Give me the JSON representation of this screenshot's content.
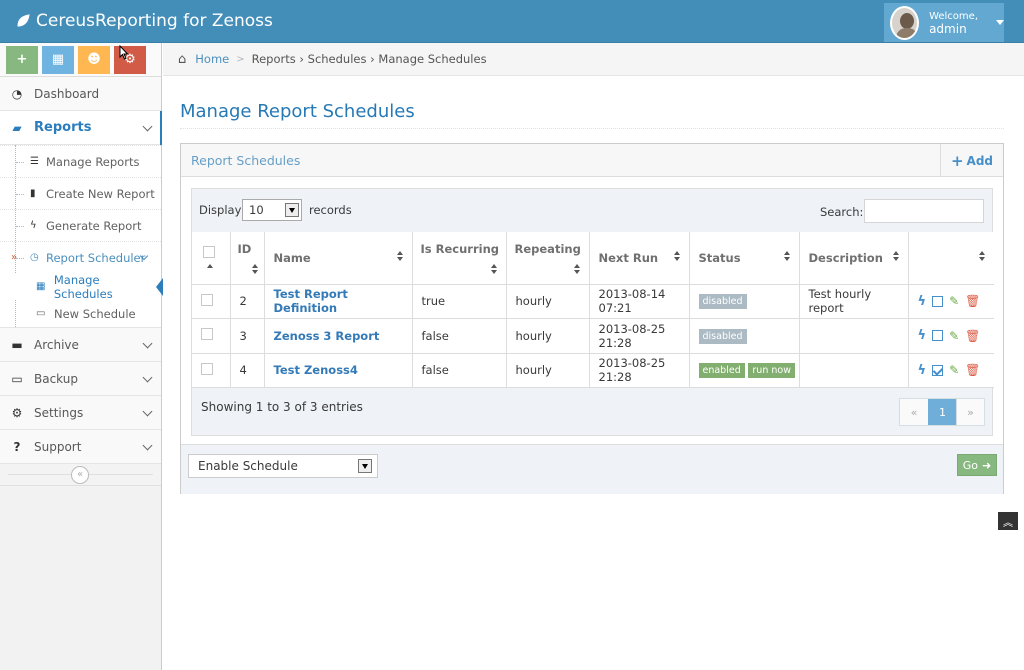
{
  "navbar": {
    "brand": "CereusReporting for Zenoss",
    "user": {
      "welcome": "Welcome,",
      "name": "admin"
    }
  },
  "sidebar": {
    "shortcuts": [
      {
        "name": "add-shortcut",
        "glyph": "+",
        "color": "#87b87f"
      },
      {
        "name": "calendar-shortcut",
        "glyph": "▦",
        "color": "#6fb3e0"
      },
      {
        "name": "users-shortcut",
        "glyph": "☻",
        "color": "#ffb752"
      },
      {
        "name": "settings-shortcut",
        "glyph": "⚙",
        "color": "#d15b47"
      }
    ],
    "dashboard": "Dashboard",
    "reports": "Reports",
    "report_items": {
      "manage": "Manage Reports",
      "create": "Create New Report",
      "generate": "Generate Report",
      "scheduler": "Report Scheduler",
      "manage_schedules": "Manage Schedules",
      "new_schedule": "New Schedule"
    },
    "archive": "Archive",
    "backup": "Backup",
    "settings": "Settings",
    "support": "Support"
  },
  "breadcrumbs": {
    "home": "Home",
    "trail": "Reports › Schedules › Manage Schedules"
  },
  "page": {
    "title": "Manage Report Schedules"
  },
  "widget": {
    "title": "Report Schedules",
    "add": "Add",
    "display_label": "Display",
    "page_length": "10",
    "records_label": "records",
    "search_label": "Search:",
    "columns": [
      "ID",
      "Name",
      "Is Recurring",
      "Repeating",
      "Next Run",
      "Status",
      "Description"
    ],
    "rows": [
      {
        "id": "2",
        "name": "Test Report Definition",
        "recurring": "true",
        "repeating": "hourly",
        "next_run": "2013-08-14 07:21",
        "status": "disabled",
        "run_now": "",
        "description": "Test hourly report",
        "checked": false
      },
      {
        "id": "3",
        "name": "Zenoss 3 Report",
        "recurring": "false",
        "repeating": "hourly",
        "next_run": "2013-08-25 21:28",
        "status": "disabled",
        "run_now": "",
        "description": "",
        "checked": false
      },
      {
        "id": "4",
        "name": "Test Zenoss4",
        "recurring": "false",
        "repeating": "hourly",
        "next_run": "2013-08-25 21:28",
        "status": "enabled",
        "run_now": "run now",
        "description": "",
        "checked": true
      }
    ],
    "showing": "Showing 1 to 3 of 3 entries",
    "pager": {
      "prev": "«",
      "current": "1",
      "next": "»"
    },
    "bulk_action": "Enable Schedule",
    "go": "Go"
  }
}
